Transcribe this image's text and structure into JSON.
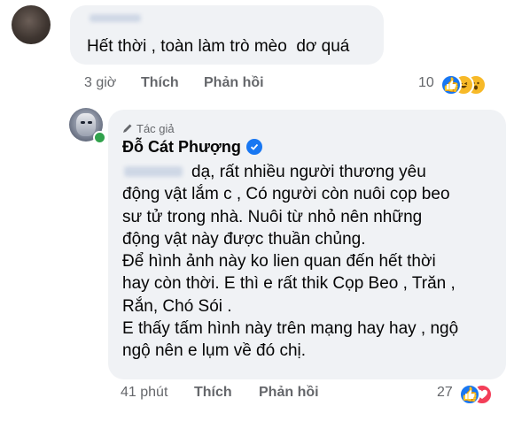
{
  "comments": [
    {
      "text": "Hết thời , toàn làm trò mèo  dơ quá",
      "time": "3 giờ",
      "like_label": "Thích",
      "reply_label": "Phản hồi",
      "reaction_count": "10",
      "reactions": [
        "like",
        "haha",
        "wow"
      ]
    },
    {
      "badge": "Tác giả",
      "author": "Đỗ Cát Phượng",
      "lines": [
        "dạ, rất nhiều người thương yêu",
        "động vật lắm c , Có người còn nuôi cọp beo",
        "sư tử trong nhà. Nuôi từ nhỏ nên những",
        "động vật này được thuần chủng.",
        "Để hình ảnh này ko lien quan đến hết thời",
        "hay còn thời. E thì e rất thik Cọp Beo , Trăn ,",
        "Rắn, Chó Sói .",
        "E thấy tấm hình này trên mạng hay hay , ngộ",
        "ngộ nên e lụm về đó chị."
      ],
      "time": "41 phút",
      "like_label": "Thích",
      "reply_label": "Phản hồi",
      "reaction_count": "27",
      "reactions": [
        "like",
        "love"
      ]
    }
  ],
  "colors": {
    "bubble": "#f0f2f5",
    "meta": "#65676b",
    "like": "#1877f2",
    "love": "#f33e58",
    "haha": "#f7b928",
    "online": "#31a24c"
  }
}
